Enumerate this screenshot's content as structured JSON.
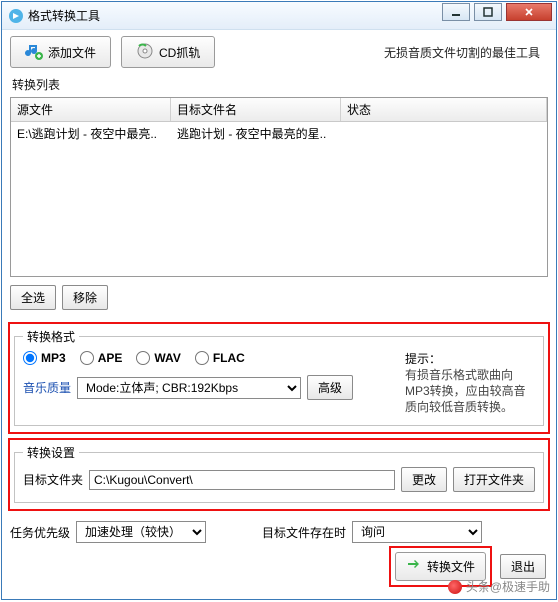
{
  "title": "格式转换工具",
  "toolbar": {
    "add_file": "添加文件",
    "cd_rip": "CD抓轨"
  },
  "tagline": "无损音质文件切割的最佳工具",
  "list_label": "转换列表",
  "columns": {
    "src": "源文件",
    "target": "目标文件名",
    "status": "状态"
  },
  "rows": [
    {
      "src": "E:\\逃跑计划 - 夜空中最亮..",
      "target": "逃跑计划 - 夜空中最亮的星..",
      "status": ""
    }
  ],
  "buttons": {
    "select_all": "全选",
    "remove": "移除",
    "advanced": "高级",
    "change": "更改",
    "open_folder": "打开文件夹",
    "convert": "转换文件",
    "exit": "退出"
  },
  "format": {
    "legend": "转换格式",
    "options": [
      "MP3",
      "APE",
      "WAV",
      "FLAC"
    ],
    "selected": "MP3",
    "quality_label": "音乐质量",
    "mode": "Mode:立体声; CBR:192Kbps"
  },
  "hint": {
    "title": "提示：",
    "body": "有损音乐格式歌曲向MP3转换，应由较高音质向较低音质转换。"
  },
  "settings": {
    "legend": "转换设置",
    "folder_label": "目标文件夹",
    "folder_path": "C:\\Kugou\\Convert\\"
  },
  "priority": {
    "label": "任务优先级",
    "value": "加速处理（较快）"
  },
  "exists": {
    "label": "目标文件存在时",
    "value": "询问"
  },
  "watermark": "头条@极速手助"
}
